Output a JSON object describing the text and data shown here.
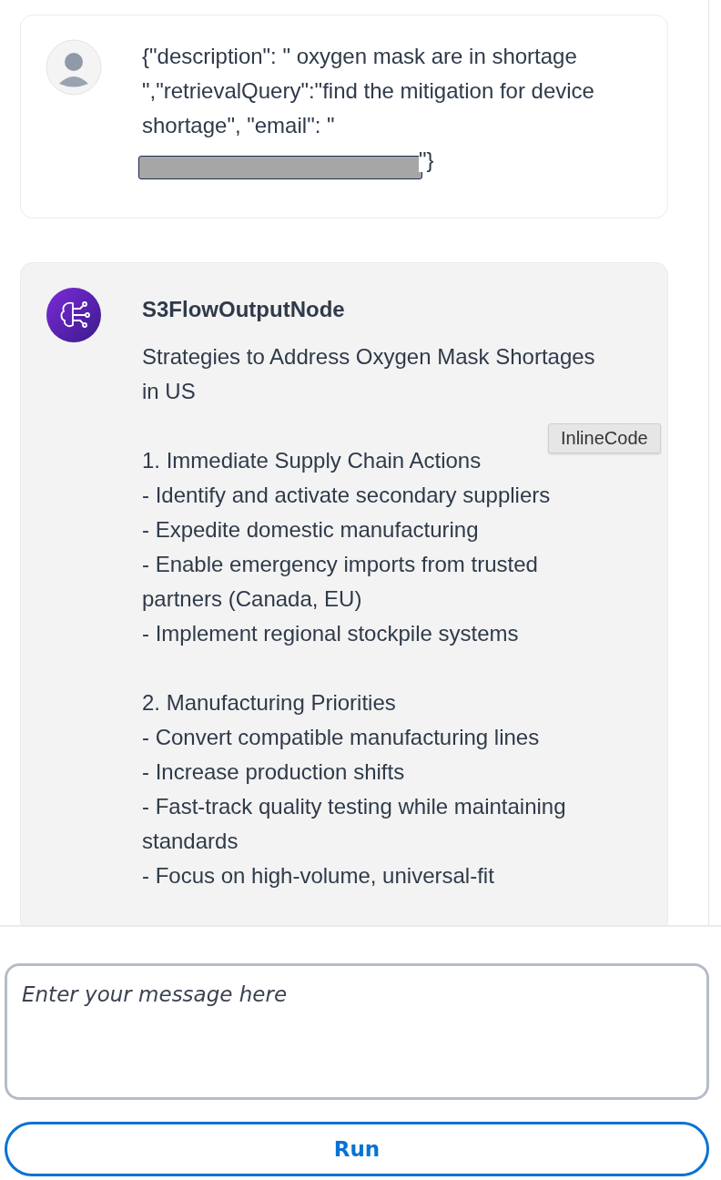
{
  "messages": [
    {
      "kind": "user",
      "text_before": "{\"description\": \" oxygen mask are in shortage \",\"retrievalQuery\":\"find the mitigation for device shortage\", \"email\": \"",
      "text_after": "\"}"
    },
    {
      "kind": "node",
      "sender": "S3FlowOutputNode",
      "title": "Strategies to Address Oxygen Mask Shortages in US",
      "sections": [
        {
          "heading": "1. Immediate Supply Chain Actions",
          "items": [
            "- Identify and activate secondary suppliers",
            "- Expedite domestic manufacturing",
            "- Enable emergency imports from trusted partners (Canada, EU)",
            "- Implement regional stockpile systems"
          ]
        },
        {
          "heading": "2. Manufacturing Priorities",
          "items": [
            "- Convert compatible manufacturing lines",
            "- Increase production shifts",
            "- Fast-track quality testing while maintaining standards",
            "- Focus on high-volume, universal-fit"
          ]
        }
      ]
    }
  ],
  "tooltip": "InlineCode",
  "composer": {
    "placeholder": "Enter your message here"
  },
  "run_button": "Run"
}
